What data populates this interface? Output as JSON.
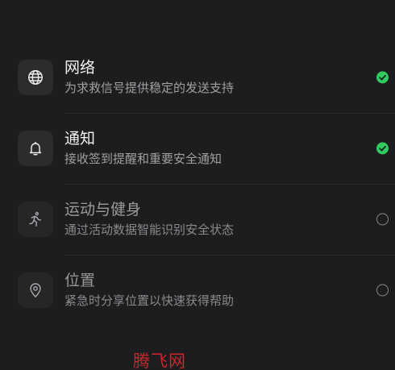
{
  "permissions": [
    {
      "title": "网络",
      "description": "为求救信号提供稳定的发送支持",
      "icon": "globe-icon",
      "enabled": true
    },
    {
      "title": "通知",
      "description": "接收签到提醒和重要安全通知",
      "icon": "bell-icon",
      "enabled": true
    },
    {
      "title": "运动与健身",
      "description": "通过活动数据智能识别安全状态",
      "icon": "running-person-icon",
      "enabled": false
    },
    {
      "title": "位置",
      "description": "紧急时分享位置以快速获得帮助",
      "icon": "location-pin-icon",
      "enabled": false
    }
  ],
  "colors": {
    "background": "#1d1d1f",
    "enabled": "#2fcb5f",
    "watermark": "#c8272b"
  },
  "watermark": "腾飞网"
}
